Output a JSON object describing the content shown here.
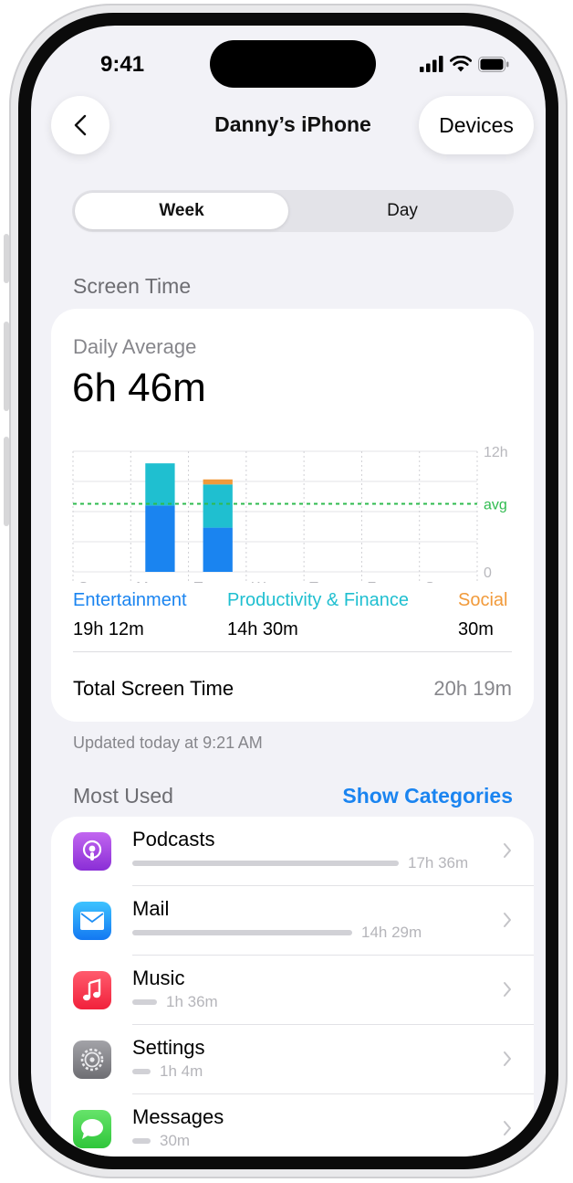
{
  "status_bar": {
    "time": "9:41"
  },
  "nav": {
    "title": "Danny’s iPhone",
    "devices_label": "Devices"
  },
  "segment": {
    "week": "Week",
    "day": "Day",
    "selected": "Week"
  },
  "screen_time": {
    "section_title": "Screen Time",
    "daily_average_label": "Daily Average",
    "daily_average_value": "6h 46m",
    "total_label": "Total Screen Time",
    "total_value": "20h 19m",
    "updated": "Updated today at 9:21 AM"
  },
  "chart_data": {
    "type": "bar",
    "categories": [
      "S",
      "M",
      "T",
      "W",
      "T",
      "F",
      "S"
    ],
    "y_tick_labels": [
      "12h",
      "avg",
      "0"
    ],
    "ylim": [
      0,
      12
    ],
    "average": 6.77,
    "series": [
      {
        "name": "Entertainment",
        "color": "#1a84f0",
        "values": [
          0,
          6.6,
          4.4,
          0,
          0,
          0,
          0
        ]
      },
      {
        "name": "Productivity & Finance",
        "color": "#1fbfd0",
        "values": [
          0,
          4.2,
          4.3,
          0,
          0,
          0,
          0
        ]
      },
      {
        "name": "Social",
        "color": "#f19a3a",
        "values": [
          0,
          0,
          0.5,
          0,
          0,
          0,
          0
        ]
      }
    ],
    "legend": [
      {
        "name": "Entertainment",
        "value": "19h 12m",
        "color": "#1a84f0"
      },
      {
        "name": "Productivity & Finance",
        "value": "14h 30m",
        "color": "#1fbfd0"
      },
      {
        "name": "Social",
        "value": "30m",
        "color": "#f19a3a"
      }
    ],
    "avg_line_color": "#2fbb4f",
    "grid": true
  },
  "most_used": {
    "title": "Most Used",
    "show_categories": "Show Categories",
    "apps": [
      {
        "name": "Podcasts",
        "time": "17h 36m",
        "icon": "podcasts-icon",
        "usage": 0.86
      },
      {
        "name": "Mail",
        "time": "14h 29m",
        "icon": "mail-icon",
        "usage": 0.71
      },
      {
        "name": "Music",
        "time": "1h 36m",
        "icon": "music-icon",
        "usage": 0.08
      },
      {
        "name": "Settings",
        "time": "1h 4m",
        "icon": "settings-icon",
        "usage": 0.05
      },
      {
        "name": "Messages",
        "time": "30m",
        "icon": "messages-icon",
        "usage": 0.03
      }
    ]
  }
}
